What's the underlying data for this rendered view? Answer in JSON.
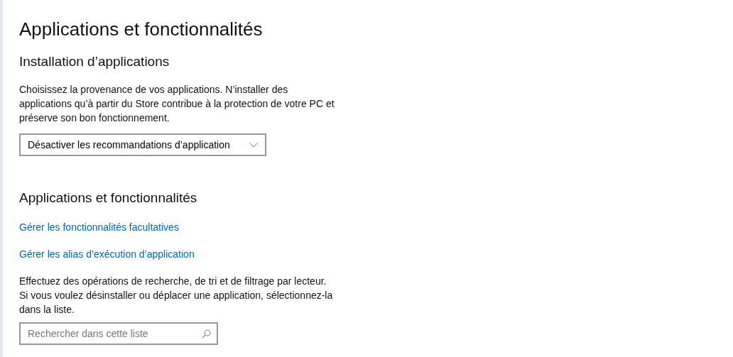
{
  "title": "Applications et fonctionnalités",
  "install_section": {
    "heading": "Installation d’applications",
    "description": "Choisissez la provenance de vos applications. N’installer des applications qu’à partir du Store contribue à la protection de votre PC et préserve son bon fonctionnement.",
    "dropdown": {
      "value": "Désactiver les recommandations d’application"
    }
  },
  "apps_section": {
    "heading": "Applications et fonctionnalités",
    "links": [
      "Gérer les fonctionnalités facultatives",
      "Gérer les alias d’exécution d’application"
    ],
    "description": "Effectuez des opérations de recherche, de tri et de filtrage par lecteur. Si vous voulez désinstaller ou déplacer une application, sélectionnez-la dans la liste.",
    "search": {
      "placeholder": "Rechercher dans cette liste"
    }
  }
}
